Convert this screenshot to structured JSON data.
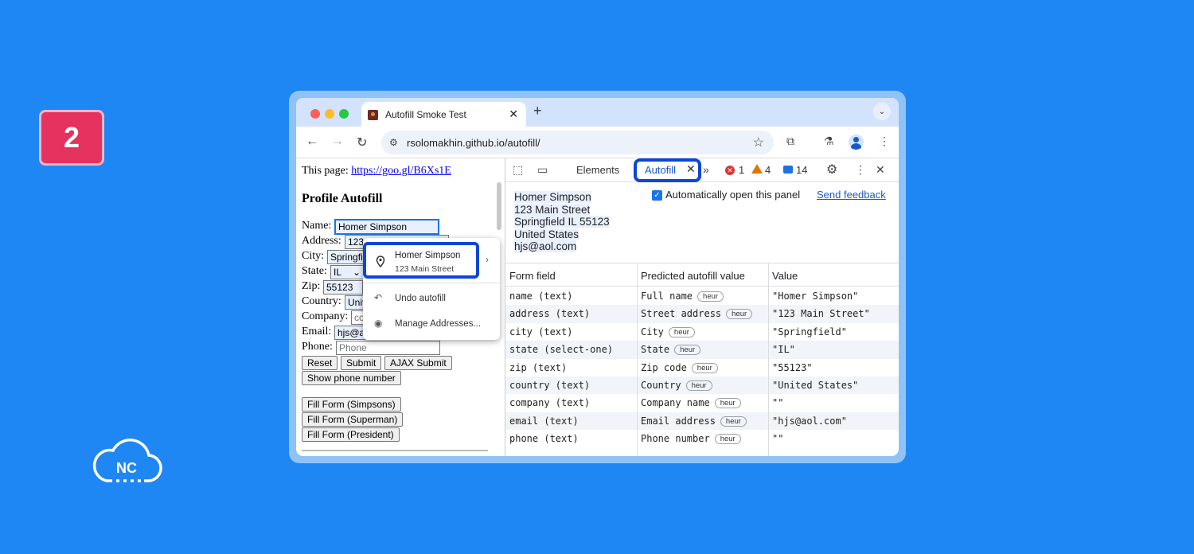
{
  "step_badge": "2",
  "brand_logo": "NC",
  "browser": {
    "tab_title": "Autofill Smoke Test",
    "url": "rsolomakhin.github.io/autofill/"
  },
  "page": {
    "this_page_label": "This page:",
    "this_page_link": "https://goo.gl/B6Xs1E",
    "heading": "Profile Autofill",
    "labels": {
      "name": "Name:",
      "address": "Address:",
      "city": "City:",
      "state": "State:",
      "zip": "Zip:",
      "country": "Country:",
      "company": "Company:",
      "email": "Email:",
      "phone": "Phone:"
    },
    "values": {
      "name": "Homer Simpson",
      "address": "123 Main Street",
      "city": "Springfield",
      "state": "IL",
      "zip": "55123",
      "country": "United States",
      "company_placeholder": "co",
      "email": "hjs@a",
      "phone_placeholder": "Phone"
    },
    "buttons": {
      "reset": "Reset",
      "submit": "Submit",
      "ajax_submit": "AJAX Submit",
      "show_phone": "Show phone number",
      "fill_simpsons": "Fill Form (Simpsons)",
      "fill_superman": "Fill Form (Superman)",
      "fill_president": "Fill Form (President)"
    }
  },
  "autofill_popup": {
    "suggestion_name": "Homer Simpson",
    "suggestion_sub": "123 Main Street",
    "undo": "Undo autofill",
    "manage": "Manage Addresses..."
  },
  "devtools": {
    "tabs": {
      "elements": "Elements",
      "autofill": "Autofill"
    },
    "error_count": "1",
    "warning_count": "4",
    "message_count": "14",
    "address_lines": [
      "Homer Simpson",
      "123 Main Street",
      "Springfield IL 55123",
      "United States",
      "hjs@aol.com"
    ],
    "auto_open_label": "Automatically open this panel",
    "send_feedback": "Send feedback",
    "columns": [
      "Form field",
      "Predicted autofill value",
      "Value"
    ],
    "heur_badge": "heur",
    "rows": [
      {
        "field": "name (text)",
        "predicted": "Full name",
        "value": "\"Homer Simpson\""
      },
      {
        "field": "address (text)",
        "predicted": "Street address",
        "value": "\"123 Main Street\""
      },
      {
        "field": "city (text)",
        "predicted": "City",
        "value": "\"Springfield\""
      },
      {
        "field": "state (select-one)",
        "predicted": "State",
        "value": "\"IL\""
      },
      {
        "field": "zip (text)",
        "predicted": "Zip code",
        "value": "\"55123\""
      },
      {
        "field": "country (text)",
        "predicted": "Country",
        "value": "\"United States\""
      },
      {
        "field": "company (text)",
        "predicted": "Company name",
        "value": "\"\""
      },
      {
        "field": "email (text)",
        "predicted": "Email address",
        "value": "\"hjs@aol.com\""
      },
      {
        "field": "phone (text)",
        "predicted": "Phone number",
        "value": "\"\""
      }
    ]
  },
  "colors": {
    "background": "#1f87f3",
    "highlight": "#0b46d6",
    "badge": "#e6325e"
  }
}
